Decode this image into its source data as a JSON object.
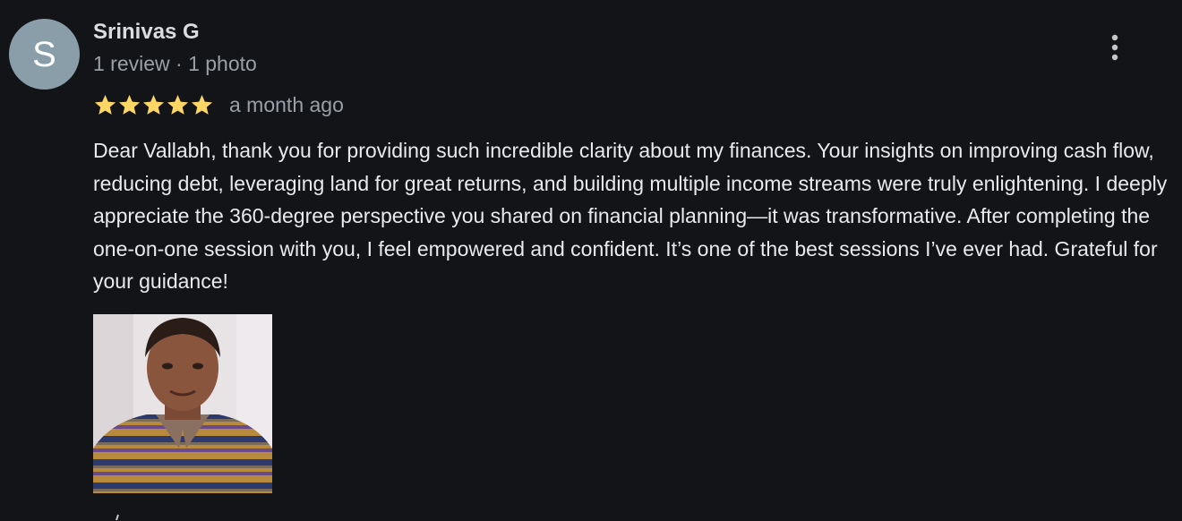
{
  "reviewer": {
    "initial": "S",
    "name": "Srinivas G",
    "meta": "1 review · 1 photo",
    "avatar_color": "#8a9ea9"
  },
  "rating": {
    "stars": 5,
    "max_stars": 5,
    "star_color": "#fdd663",
    "date": "a month ago"
  },
  "review": {
    "text": "Dear Vallabh, thank you for providing such incredible clarity about my finances. Your insights on improving cash flow, reducing debt, leveraging land for great returns, and building multiple income streams were truly enlightening. I deeply appreciate the 360-degree perspective you shared on financial planning—it was transformative. After completing the one-on-one session with you, I feel empowered and confident. It’s one of the best sessions I’ve ever had. Grateful for your guidance!"
  },
  "icons": {
    "menu": "more-vertical-icon",
    "star": "star-icon",
    "like": "thumb-up-icon"
  },
  "photo": {
    "count": 1
  }
}
